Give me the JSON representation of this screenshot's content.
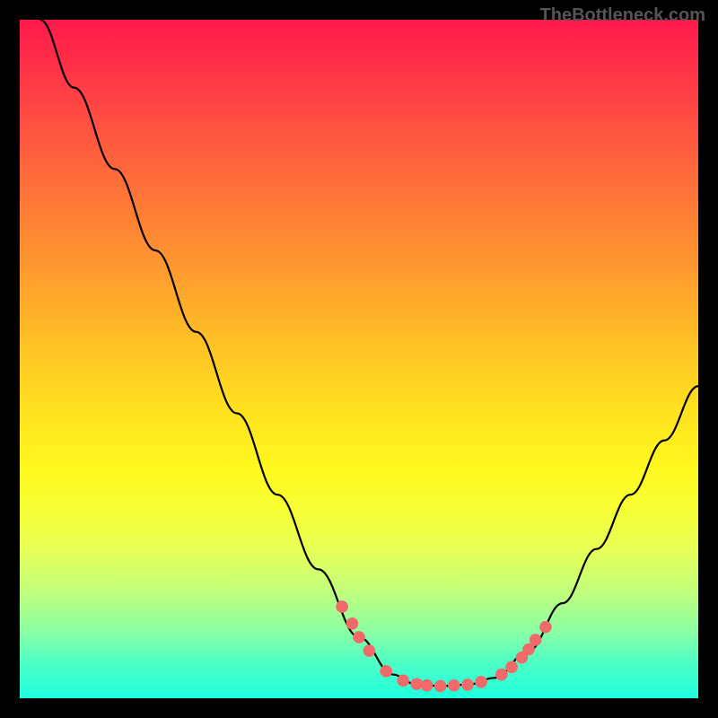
{
  "watermark": "TheBottleneck.com",
  "chart_data": {
    "type": "line",
    "title": "",
    "xlabel": "",
    "ylabel": "",
    "xlim": [
      0,
      100
    ],
    "ylim": [
      0,
      100
    ],
    "curve": [
      {
        "x": 3,
        "y": 100
      },
      {
        "x": 8,
        "y": 90
      },
      {
        "x": 14,
        "y": 78
      },
      {
        "x": 20,
        "y": 66
      },
      {
        "x": 26,
        "y": 54
      },
      {
        "x": 32,
        "y": 42
      },
      {
        "x": 38,
        "y": 30
      },
      {
        "x": 44,
        "y": 19
      },
      {
        "x": 50,
        "y": 9
      },
      {
        "x": 55,
        "y": 3.5
      },
      {
        "x": 58,
        "y": 2.2
      },
      {
        "x": 62,
        "y": 1.8
      },
      {
        "x": 66,
        "y": 2.0
      },
      {
        "x": 70,
        "y": 3.0
      },
      {
        "x": 75,
        "y": 7
      },
      {
        "x": 80,
        "y": 14
      },
      {
        "x": 85,
        "y": 22
      },
      {
        "x": 90,
        "y": 30
      },
      {
        "x": 95,
        "y": 38
      },
      {
        "x": 100,
        "y": 46
      }
    ],
    "markers": [
      {
        "x": 47.5,
        "y": 13.5
      },
      {
        "x": 49.0,
        "y": 11.0
      },
      {
        "x": 50.0,
        "y": 9.0
      },
      {
        "x": 51.5,
        "y": 7.0
      },
      {
        "x": 54.0,
        "y": 4.0
      },
      {
        "x": 56.5,
        "y": 2.6
      },
      {
        "x": 58.5,
        "y": 2.1
      },
      {
        "x": 60.0,
        "y": 1.9
      },
      {
        "x": 62.0,
        "y": 1.8
      },
      {
        "x": 64.0,
        "y": 1.9
      },
      {
        "x": 66.0,
        "y": 2.0
      },
      {
        "x": 68.0,
        "y": 2.4
      },
      {
        "x": 71.0,
        "y": 3.5
      },
      {
        "x": 72.5,
        "y": 4.6
      },
      {
        "x": 74.0,
        "y": 6.0
      },
      {
        "x": 75.0,
        "y": 7.2
      },
      {
        "x": 76.0,
        "y": 8.6
      },
      {
        "x": 77.5,
        "y": 10.5
      }
    ],
    "marker_color": "#f06a6a",
    "curve_color": "#000000"
  }
}
